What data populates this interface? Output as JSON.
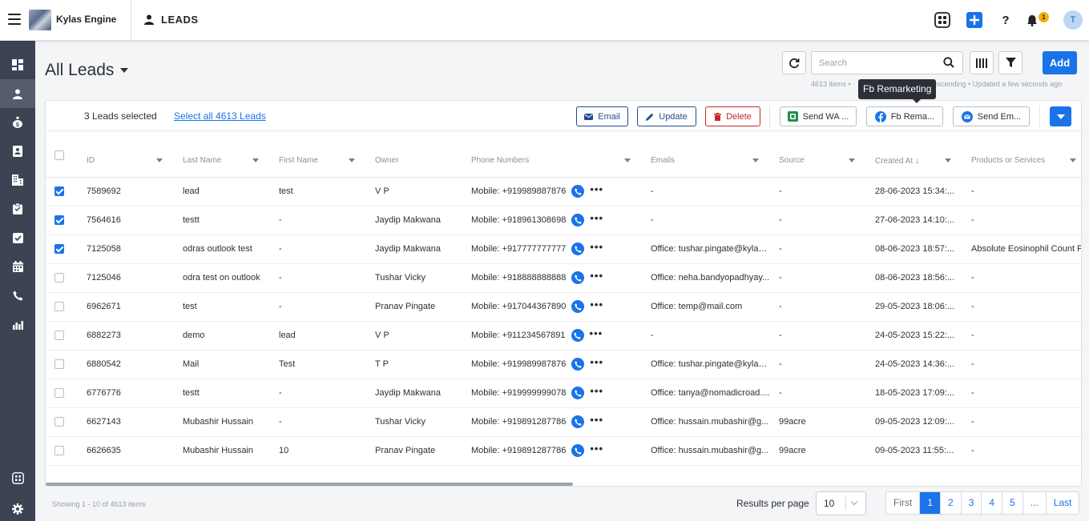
{
  "app": {
    "brand": "Kylas Engine",
    "module": "LEADS",
    "notifications": "1",
    "user_initial": "T"
  },
  "page": {
    "title": "All Leads",
    "search_placeholder": "Search",
    "add_label": "Add",
    "meta_count": "4613 items •",
    "meta_sort": "Descending • Updated a few seconds ago"
  },
  "tooltip": "Fb Remarketing",
  "bulk": {
    "selected_text": "3 Leads selected",
    "select_all": "Select all 4613 Leads",
    "email": "Email",
    "update": "Update",
    "delete": "Delete",
    "send_wa": "Send WA ...",
    "fb_remarketing": "Fb Rema...",
    "send_email": "Send Em..."
  },
  "table": {
    "headers": [
      "ID",
      "Last Name",
      "First Name",
      "Owner",
      "Phone Numbers",
      "Emails",
      "Source",
      "Created At",
      "Products or Services"
    ],
    "rows": [
      {
        "checked": true,
        "cells": [
          "7589692",
          "lead",
          "test",
          "V P",
          "Mobile: +919989887876",
          "-",
          "-",
          "28-06-2023 15:34:...",
          "-"
        ]
      },
      {
        "checked": true,
        "cells": [
          "7564616",
          "testt",
          "-",
          "Jaydip Makwana",
          "Mobile: +918961308698",
          "-",
          "-",
          "27-06-2023 14:10:...",
          "-"
        ]
      },
      {
        "checked": true,
        "cells": [
          "7125058",
          "odras outlook test",
          "-",
          "Jaydip Makwana",
          "Mobile: +917777777777",
          "Office: tushar.pingate@kylas....",
          "-",
          "08-06-2023 18:57:...",
          "Absolute Eosinophil Count P"
        ]
      },
      {
        "checked": false,
        "cells": [
          "7125046",
          "odra test on outlook",
          "-",
          "Tushar Vicky",
          "Mobile: +918888888888",
          "Office: neha.bandyopadhyay...",
          "-",
          "08-06-2023 18:56:...",
          "-"
        ]
      },
      {
        "checked": false,
        "cells": [
          "6962671",
          "test",
          "-",
          "Pranav Pingate",
          "Mobile: +917044367890",
          "Office: temp@mail.com",
          "-",
          "29-05-2023 18:06:...",
          "-"
        ]
      },
      {
        "checked": false,
        "cells": [
          "6882273",
          "demo",
          "lead",
          "V P",
          "Mobile: +911234567891",
          "-",
          "-",
          "24-05-2023 15:22:...",
          "-"
        ]
      },
      {
        "checked": false,
        "cells": [
          "6880542",
          "Mail",
          "Test",
          "T P",
          "Mobile: +919989987876",
          "Office: tushar.pingate@kylas....",
          "-",
          "24-05-2023 14:36:...",
          "-"
        ]
      },
      {
        "checked": false,
        "cells": [
          "6776776",
          "testt",
          "-",
          "Jaydip Makwana",
          "Mobile: +919999999078",
          "Office: tanya@nomadicroad....",
          "-",
          "18-05-2023 17:09:...",
          "-"
        ]
      },
      {
        "checked": false,
        "cells": [
          "6627143",
          "Mubashir Hussain",
          "-",
          "Tushar Vicky",
          "Mobile: +919891287786",
          "Office: hussain.mubashir@g...",
          "99acre",
          "09-05-2023 12:09:...",
          "-"
        ]
      },
      {
        "checked": false,
        "cells": [
          "6626635",
          "Mubashir Hussain",
          "10",
          "Pranav Pingate",
          "Mobile: +919891287786",
          "Office: hussain.mubashir@g...",
          "99acre",
          "09-05-2023 11:55:...",
          "-"
        ]
      }
    ]
  },
  "footer": {
    "showing": "Showing 1 - 10 of 4613 items",
    "rpp_label": "Results per page",
    "rpp_value": "10",
    "pages": [
      "First",
      "1",
      "2",
      "3",
      "4",
      "5",
      "...",
      "Last"
    ],
    "active_page": "1"
  },
  "colors": {
    "accent": "#1a73e8",
    "sidebar": "#3c4353",
    "danger": "#c62828"
  }
}
